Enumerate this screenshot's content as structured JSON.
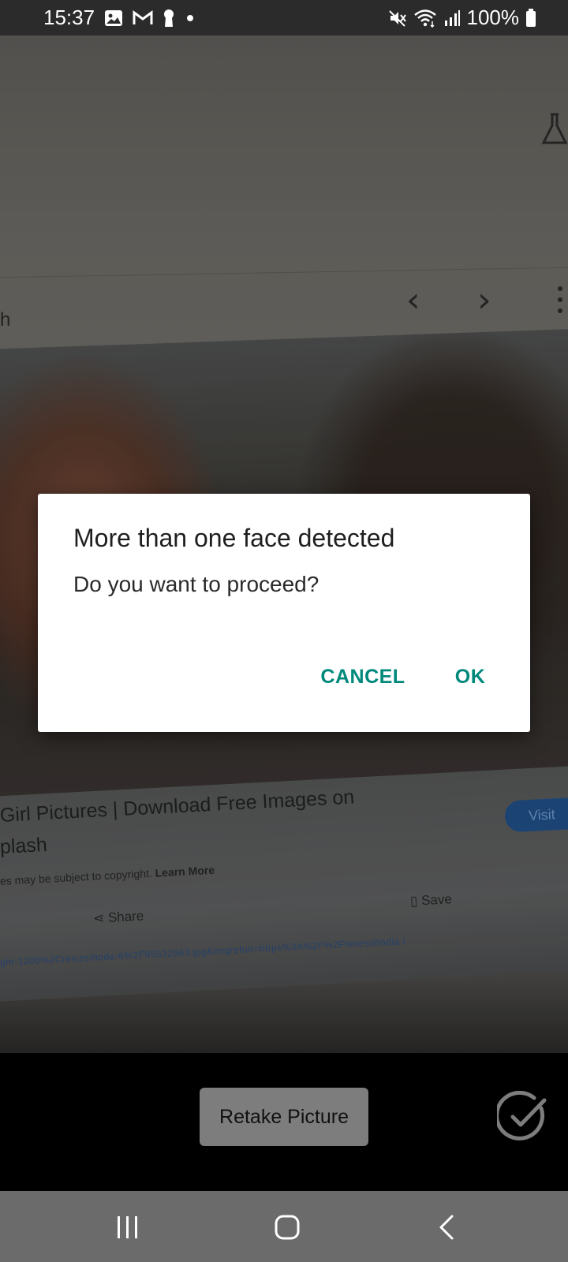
{
  "status_bar": {
    "time": "15:37",
    "battery": "100%",
    "left_icons": [
      "gallery-icon",
      "gmail-icon",
      "keyhole-icon",
      "dot-icon"
    ],
    "right_icons": [
      "mute-icon",
      "wifi-icon",
      "signal-icon",
      "battery-icon"
    ]
  },
  "preview": {
    "edge_letter": "h",
    "caption_title_line1": "Girl Pictures | Download Free Images on",
    "caption_title_line2": "plash",
    "copyright_prefix": "es may be subject to copyright.",
    "copyright_link": "Learn More",
    "visit_label": "Visit",
    "share_label": "Share",
    "save_label": "Save",
    "url_text": "ght-1200%2Cresizemode-6%2F95532963.jpg&imgrefurl=https%3A%2F%2Ftimesofindia.i"
  },
  "dialog": {
    "title": "More than one face detected",
    "message": "Do you want to proceed?",
    "cancel_label": "CANCEL",
    "ok_label": "OK",
    "accent_color": "#00897b"
  },
  "controls": {
    "retake_label": "Retake Picture",
    "confirm_icon": "check-circle-icon"
  },
  "system_nav": {
    "icons": [
      "recents-icon",
      "home-icon",
      "back-icon"
    ]
  }
}
